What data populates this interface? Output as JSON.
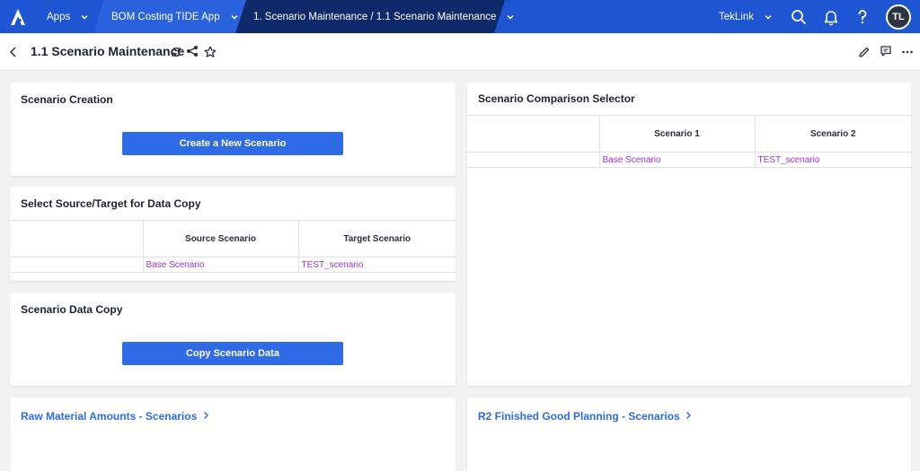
{
  "topbar": {
    "apps_label": "Apps",
    "app_name": "BOM Costing TIDE App",
    "current_page": "1. Scenario Maintenance / 1.1 Scenario Maintenance",
    "tenant": "TekLink",
    "avatar_initials": "TL",
    "icons": [
      "anaplan-logo-icon",
      "search-icon",
      "bell-icon",
      "help-icon"
    ]
  },
  "page": {
    "title": "1.1 Scenario Maintenance",
    "icons": [
      "back-icon",
      "refresh-icon",
      "share-icon",
      "star-icon",
      "edit-icon",
      "comment-icon",
      "more-icon"
    ]
  },
  "scenario_creation": {
    "title": "Scenario Creation",
    "button_label": "Create a New Scenario"
  },
  "data_copy_select": {
    "title": "Select Source/Target for Data Copy",
    "columns": [
      "",
      "Source Scenario",
      "Target Scenario"
    ],
    "row": [
      "",
      "Base Scenario",
      "TEST_scenario"
    ]
  },
  "scenario_data_copy": {
    "title": "Scenario Data Copy",
    "button_label": "Copy Scenario Data"
  },
  "comparison": {
    "title": "Scenario Comparison Selector",
    "columns": [
      "",
      "Scenario 1",
      "Scenario 2"
    ],
    "row": [
      "",
      "Base Scenario",
      "TEST_scenario"
    ]
  },
  "links": {
    "raw_material": "Raw Material Amounts - Scenarios",
    "finished_good": "R2 Finished Good Planning - Scenarios"
  },
  "colors": {
    "nav_blue": "#1d55d3",
    "nav_dark": "#0e2a6b",
    "button_blue": "#2f6be6",
    "cell_purple": "#9b36d9"
  }
}
